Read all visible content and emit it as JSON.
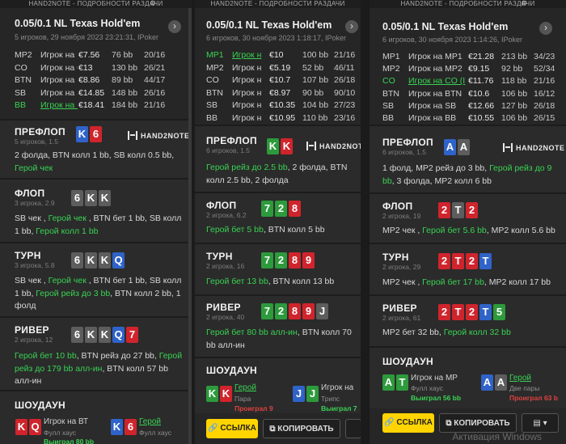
{
  "app_title": "HAND2NOTE - ПОДРОБНОСТИ РАЗДАЧИ",
  "brand_logo": "HAND2NOTE",
  "colors": {
    "accent_yellow": "#ffd400",
    "hero_green": "#39d353",
    "lost_red": "#e04040",
    "card_blue": "#2f63c9",
    "card_red": "#d0242c",
    "card_green": "#2d9a3c",
    "card_gray": "#5d5d5d"
  },
  "watermark": "Активация Windows",
  "panels": [
    {
      "title": "0.05/0.1 NL Texas Hold'em",
      "subtitle": "5 игроков, 29 ноября 2023 23:21:31, IPoker",
      "players": [
        {
          "pos": "MP2",
          "name": "Игрок на MP",
          "stack": "€7.56",
          "bb": "76 bb",
          "vpip": "20/16",
          "hero": false
        },
        {
          "pos": "CO",
          "name": "Игрок на CO",
          "stack": "€13",
          "bb": "130 bb",
          "vpip": "26/21",
          "hero": false
        },
        {
          "pos": "BTN",
          "name": "Игрок на BT",
          "stack": "€8.86",
          "bb": "89 bb",
          "vpip": "44/17",
          "hero": false
        },
        {
          "pos": "SB",
          "name": "Игрок на SB",
          "stack": "€14.85",
          "bb": "148 bb",
          "vpip": "26/16",
          "hero": false
        },
        {
          "pos": "BB",
          "name": "Игрок на BB",
          "stack": "€18.41",
          "bb": "184 bb",
          "vpip": "21/16",
          "hero": true
        }
      ],
      "preflop": {
        "label": "ПРЕФЛОП",
        "sub": "5 игроков, 1.5",
        "cards": [
          {
            "r": "K",
            "c": "b"
          },
          {
            "r": "6",
            "c": "r"
          }
        ],
        "action": [
          [
            "2 фолда, BTN колл 1 bb, SB колл 0.5 bb,"
          ],
          [
            "Герой чек"
          ]
        ]
      },
      "flop": {
        "label": "ФЛОП",
        "sub": "3 игрока, 2.9",
        "cards": [
          {
            "r": "6",
            "c": "k"
          },
          {
            "r": "K",
            "c": "k"
          },
          {
            "r": "K",
            "c": "k"
          }
        ],
        "action": "SB чек , Герой чек , BTN бет 1 bb, SB колл 1 bb, Герой колл 1 bb"
      },
      "turn": {
        "label": "ТУРН",
        "sub": "3 игрока, 5.8",
        "cards": [
          {
            "r": "6",
            "c": "k"
          },
          {
            "r": "K",
            "c": "k"
          },
          {
            "r": "K",
            "c": "k"
          },
          {
            "r": "Q",
            "c": "b"
          }
        ],
        "action": "SB чек , Герой чек , BTN бет 1 bb, SB колл 1 bb, Герой рейз до 3 bb, BTN колл 2 bb, 1 фолд"
      },
      "river": {
        "label": "РИВЕР",
        "sub": "2 игрока, 12",
        "cards": [
          {
            "r": "6",
            "c": "k"
          },
          {
            "r": "K",
            "c": "k"
          },
          {
            "r": "K",
            "c": "k"
          },
          {
            "r": "Q",
            "c": "b"
          },
          {
            "r": "7",
            "c": "r"
          }
        ],
        "action": "Герой бет 10 bb, BTN рейз до 27 bb, Герой рейз до 179 bb алл-ин, BTN колл 57 bb алл-ин"
      },
      "showdown": {
        "label": "ШОУДАУН",
        "p1": {
          "name": "Игрок на ВТ",
          "hand": "Фулл хаус",
          "result": "Выиграл 80 bb",
          "cards": [
            {
              "r": "K",
              "c": "r"
            },
            {
              "r": "Q",
              "c": "r"
            }
          ]
        },
        "p2": {
          "name": "Герой",
          "hand": "Фулл хаус",
          "result": "",
          "cards": [
            {
              "r": "K",
              "c": "b"
            },
            {
              "r": "6",
              "c": "r"
            }
          ]
        }
      }
    },
    {
      "title": "0.05/0.1 NL Texas Hold'em",
      "subtitle": "6 игроков, 30 ноября 2023 1:18:17, IPoker",
      "players": [
        {
          "pos": "MP1",
          "name": "Игрок н",
          "stack": "€10",
          "bb": "100 bb",
          "vpip": "21/16",
          "hero": true
        },
        {
          "pos": "MP2",
          "name": "Игрок н",
          "stack": "€5.19",
          "bb": "52 bb",
          "vpip": "46/11",
          "hero": false
        },
        {
          "pos": "CO",
          "name": "Игрок н",
          "stack": "€10.7",
          "bb": "107 bb",
          "vpip": "26/18",
          "hero": false
        },
        {
          "pos": "BTN",
          "name": "Игрок н",
          "stack": "€8.97",
          "bb": "90 bb",
          "vpip": "90/10",
          "hero": false
        },
        {
          "pos": "SB",
          "name": "Игрок н",
          "stack": "€10.35",
          "bb": "104 bb",
          "vpip": "27/23",
          "hero": false
        },
        {
          "pos": "BB",
          "name": "Игрок н",
          "stack": "€10.95",
          "bb": "110 bb",
          "vpip": "23/16",
          "hero": false
        }
      ],
      "preflop": {
        "label": "ПРЕФЛОП",
        "sub": "6 игроков, 1.5",
        "cards": [
          {
            "r": "K",
            "c": "g"
          },
          {
            "r": "K",
            "c": "r"
          }
        ],
        "action": "Герой рейз до 2.5 bb, 2 фолда, BTN колл 2.5 bb, 2 фолда"
      },
      "flop": {
        "label": "ФЛОП",
        "sub": "2 игрока, 6.2",
        "cards": [
          {
            "r": "7",
            "c": "g"
          },
          {
            "r": "2",
            "c": "g"
          },
          {
            "r": "8",
            "c": "r"
          }
        ],
        "action": "Герой бет 5 bb, BTN колл 5 bb"
      },
      "turn": {
        "label": "ТУРН",
        "sub": "2 игрока, 16",
        "cards": [
          {
            "r": "7",
            "c": "g"
          },
          {
            "r": "2",
            "c": "g"
          },
          {
            "r": "8",
            "c": "r"
          },
          {
            "r": "9",
            "c": "r"
          }
        ],
        "action": "Герой бет 13 bb, BTN колл 13 bb"
      },
      "river": {
        "label": "РИВЕР",
        "sub": "2 игрока, 40",
        "cards": [
          {
            "r": "7",
            "c": "g"
          },
          {
            "r": "2",
            "c": "g"
          },
          {
            "r": "8",
            "c": "r"
          },
          {
            "r": "9",
            "c": "r"
          },
          {
            "r": "J",
            "c": "k"
          }
        ],
        "action": "Герой бет 80 bb алл-ин, BTN колл 70 bb алл-ин"
      },
      "showdown": {
        "label": "ШОУДАУН",
        "p1": {
          "name": "Герой",
          "hand": "Пара",
          "result": "Проиграл 9",
          "cards": [
            {
              "r": "K",
              "c": "g"
            },
            {
              "r": "K",
              "c": "r"
            }
          ]
        },
        "p2": {
          "name": "Игрок на",
          "hand": "Трипс",
          "result": "Выиграл 7",
          "cards": [
            {
              "r": "J",
              "c": "b"
            },
            {
              "r": "J",
              "c": "g"
            }
          ]
        }
      }
    },
    {
      "title": "0.05/0.1 NL Texas Hold'em",
      "subtitle": "6 игроков, 30 ноября 2023 1:14:26, IPoker",
      "players": [
        {
          "pos": "MP1",
          "name": "Игрок на MP1",
          "stack": "€21.28",
          "bb": "213 bb",
          "vpip": "34/23",
          "hero": false
        },
        {
          "pos": "MP2",
          "name": "Игрок на MP2",
          "stack": "€9.15",
          "bb": "92 bb",
          "vpip": "52/34",
          "hero": false
        },
        {
          "pos": "CO",
          "name": "Игрок на CO (I",
          "stack": "€11.76",
          "bb": "118 bb",
          "vpip": "21/16",
          "hero": true
        },
        {
          "pos": "BTN",
          "name": "Игрок на BTN",
          "stack": "€10.6",
          "bb": "106 bb",
          "vpip": "16/12",
          "hero": false
        },
        {
          "pos": "SB",
          "name": "Игрок на SB",
          "stack": "€12.66",
          "bb": "127 bb",
          "vpip": "26/18",
          "hero": false
        },
        {
          "pos": "BB",
          "name": "Игрок на BB",
          "stack": "€10.55",
          "bb": "106 bb",
          "vpip": "26/15",
          "hero": false
        }
      ],
      "preflop": {
        "label": "ПРЕФЛОП",
        "sub": "6 игроков, 1.5",
        "cards": [
          {
            "r": "A",
            "c": "b"
          },
          {
            "r": "A",
            "c": "k"
          }
        ],
        "action": "1 фолд, MP2 рейз до 3 bb, Герой рейз до 9 bb, 3 фолда, MP2 колл 6 bb"
      },
      "flop": {
        "label": "ФЛОП",
        "sub": "2 игрока, 19",
        "cards": [
          {
            "r": "2",
            "c": "r"
          },
          {
            "r": "T",
            "c": "k"
          },
          {
            "r": "2",
            "c": "r"
          }
        ],
        "action": "MP2 чек , Герой бет 5.6 bb, MP2 колл 5.6 bb"
      },
      "turn": {
        "label": "ТУРН",
        "sub": "2 игрока, 29",
        "cards": [
          {
            "r": "2",
            "c": "r"
          },
          {
            "r": "T",
            "c": "r"
          },
          {
            "r": "2",
            "c": "r"
          },
          {
            "r": "T",
            "c": "b"
          }
        ],
        "action": "MP2 чек , Герой бет 17 bb, MP2 колл 17 bb"
      },
      "river": {
        "label": "РИВЕР",
        "sub": "2 игрока, 61",
        "cards": [
          {
            "r": "2",
            "c": "r"
          },
          {
            "r": "T",
            "c": "r"
          },
          {
            "r": "2",
            "c": "r"
          },
          {
            "r": "T",
            "c": "b"
          },
          {
            "r": "5",
            "c": "g"
          }
        ],
        "action": "MP2 бет 32 bb, Герой колл 32 bb"
      },
      "showdown": {
        "label": "ШОУДАУН",
        "p1": {
          "name": "Игрок на MP",
          "hand": "Фулл хаус",
          "result": "Выиграл 56 bb",
          "cards": [
            {
              "r": "A",
              "c": "g"
            },
            {
              "r": "T",
              "c": "g"
            }
          ]
        },
        "p2": {
          "name": "Герой",
          "hand": "Две пары",
          "result": "Проиграл 63 b",
          "cards": [
            {
              "r": "A",
              "c": "b"
            },
            {
              "r": "A",
              "c": "k"
            }
          ]
        }
      }
    }
  ],
  "footer": {
    "link_label": "ССЫЛКА",
    "copy_label": "КОПИРОВАТЬ"
  }
}
